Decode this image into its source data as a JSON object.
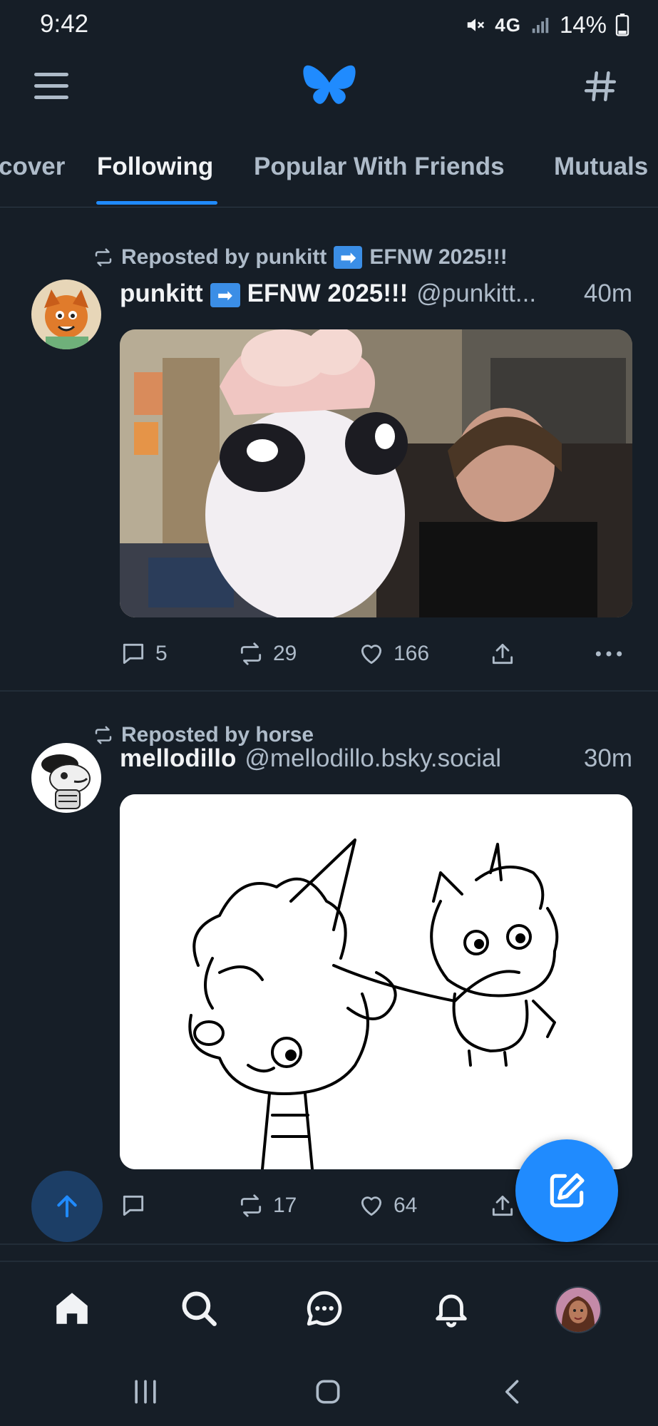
{
  "status_bar": {
    "time": "9:42",
    "network": "4G",
    "battery": "14%"
  },
  "header": {
    "logo_icon": "butterfly-logo-icon",
    "menu_icon": "hamburger-menu-icon",
    "feeds_icon": "hashtag-icon",
    "accent": "#208bfe"
  },
  "tabs": {
    "items": [
      {
        "label": "Discover",
        "visible_text": "cover"
      },
      {
        "label": "Following",
        "visible_text": "Following",
        "active": true
      },
      {
        "label": "Popular With Friends",
        "visible_text": "Popular With Friends"
      },
      {
        "label": "Mutuals",
        "visible_text": "Mutuals"
      }
    ]
  },
  "posts": [
    {
      "repost_label": "Reposted by punkitt",
      "repost_suffix": "EFNW 2025!!!",
      "author_name": "punkitt",
      "author_name_suffix": "EFNW 2025!!!",
      "handle": "@punkitt...",
      "time": "40m",
      "image_description": "photo-of-plush-and-person",
      "replies": "5",
      "reposts": "29",
      "likes": "166"
    },
    {
      "repost_label": "Reposted by horse",
      "author_name": "mellodillo",
      "handle": "@mellodillo.bsky.social",
      "time": "30m",
      "image_description": "line-drawing-of-creatures",
      "replies": "",
      "reposts": "17",
      "likes": "64"
    }
  ],
  "bottom_nav": {
    "items": [
      "home-icon",
      "search-icon",
      "chat-icon",
      "notifications-icon",
      "profile-avatar"
    ]
  }
}
